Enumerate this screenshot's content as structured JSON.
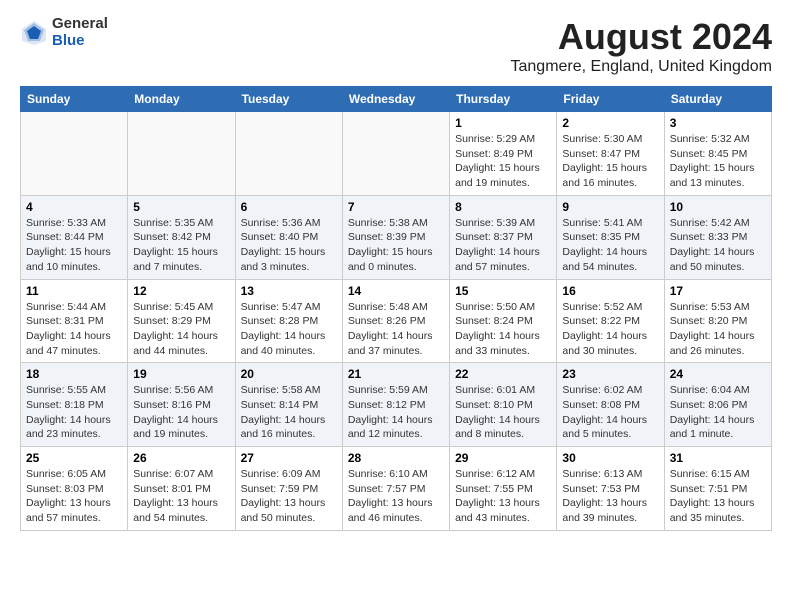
{
  "header": {
    "logo_general": "General",
    "logo_blue": "Blue",
    "month_title": "August 2024",
    "location": "Tangmere, England, United Kingdom"
  },
  "weekdays": [
    "Sunday",
    "Monday",
    "Tuesday",
    "Wednesday",
    "Thursday",
    "Friday",
    "Saturday"
  ],
  "weeks": [
    [
      {
        "day": "",
        "info": ""
      },
      {
        "day": "",
        "info": ""
      },
      {
        "day": "",
        "info": ""
      },
      {
        "day": "",
        "info": ""
      },
      {
        "day": "1",
        "info": "Sunrise: 5:29 AM\nSunset: 8:49 PM\nDaylight: 15 hours\nand 19 minutes."
      },
      {
        "day": "2",
        "info": "Sunrise: 5:30 AM\nSunset: 8:47 PM\nDaylight: 15 hours\nand 16 minutes."
      },
      {
        "day": "3",
        "info": "Sunrise: 5:32 AM\nSunset: 8:45 PM\nDaylight: 15 hours\nand 13 minutes."
      }
    ],
    [
      {
        "day": "4",
        "info": "Sunrise: 5:33 AM\nSunset: 8:44 PM\nDaylight: 15 hours\nand 10 minutes."
      },
      {
        "day": "5",
        "info": "Sunrise: 5:35 AM\nSunset: 8:42 PM\nDaylight: 15 hours\nand 7 minutes."
      },
      {
        "day": "6",
        "info": "Sunrise: 5:36 AM\nSunset: 8:40 PM\nDaylight: 15 hours\nand 3 minutes."
      },
      {
        "day": "7",
        "info": "Sunrise: 5:38 AM\nSunset: 8:39 PM\nDaylight: 15 hours\nand 0 minutes."
      },
      {
        "day": "8",
        "info": "Sunrise: 5:39 AM\nSunset: 8:37 PM\nDaylight: 14 hours\nand 57 minutes."
      },
      {
        "day": "9",
        "info": "Sunrise: 5:41 AM\nSunset: 8:35 PM\nDaylight: 14 hours\nand 54 minutes."
      },
      {
        "day": "10",
        "info": "Sunrise: 5:42 AM\nSunset: 8:33 PM\nDaylight: 14 hours\nand 50 minutes."
      }
    ],
    [
      {
        "day": "11",
        "info": "Sunrise: 5:44 AM\nSunset: 8:31 PM\nDaylight: 14 hours\nand 47 minutes."
      },
      {
        "day": "12",
        "info": "Sunrise: 5:45 AM\nSunset: 8:29 PM\nDaylight: 14 hours\nand 44 minutes."
      },
      {
        "day": "13",
        "info": "Sunrise: 5:47 AM\nSunset: 8:28 PM\nDaylight: 14 hours\nand 40 minutes."
      },
      {
        "day": "14",
        "info": "Sunrise: 5:48 AM\nSunset: 8:26 PM\nDaylight: 14 hours\nand 37 minutes."
      },
      {
        "day": "15",
        "info": "Sunrise: 5:50 AM\nSunset: 8:24 PM\nDaylight: 14 hours\nand 33 minutes."
      },
      {
        "day": "16",
        "info": "Sunrise: 5:52 AM\nSunset: 8:22 PM\nDaylight: 14 hours\nand 30 minutes."
      },
      {
        "day": "17",
        "info": "Sunrise: 5:53 AM\nSunset: 8:20 PM\nDaylight: 14 hours\nand 26 minutes."
      }
    ],
    [
      {
        "day": "18",
        "info": "Sunrise: 5:55 AM\nSunset: 8:18 PM\nDaylight: 14 hours\nand 23 minutes."
      },
      {
        "day": "19",
        "info": "Sunrise: 5:56 AM\nSunset: 8:16 PM\nDaylight: 14 hours\nand 19 minutes."
      },
      {
        "day": "20",
        "info": "Sunrise: 5:58 AM\nSunset: 8:14 PM\nDaylight: 14 hours\nand 16 minutes."
      },
      {
        "day": "21",
        "info": "Sunrise: 5:59 AM\nSunset: 8:12 PM\nDaylight: 14 hours\nand 12 minutes."
      },
      {
        "day": "22",
        "info": "Sunrise: 6:01 AM\nSunset: 8:10 PM\nDaylight: 14 hours\nand 8 minutes."
      },
      {
        "day": "23",
        "info": "Sunrise: 6:02 AM\nSunset: 8:08 PM\nDaylight: 14 hours\nand 5 minutes."
      },
      {
        "day": "24",
        "info": "Sunrise: 6:04 AM\nSunset: 8:06 PM\nDaylight: 14 hours\nand 1 minute."
      }
    ],
    [
      {
        "day": "25",
        "info": "Sunrise: 6:05 AM\nSunset: 8:03 PM\nDaylight: 13 hours\nand 57 minutes."
      },
      {
        "day": "26",
        "info": "Sunrise: 6:07 AM\nSunset: 8:01 PM\nDaylight: 13 hours\nand 54 minutes."
      },
      {
        "day": "27",
        "info": "Sunrise: 6:09 AM\nSunset: 7:59 PM\nDaylight: 13 hours\nand 50 minutes."
      },
      {
        "day": "28",
        "info": "Sunrise: 6:10 AM\nSunset: 7:57 PM\nDaylight: 13 hours\nand 46 minutes."
      },
      {
        "day": "29",
        "info": "Sunrise: 6:12 AM\nSunset: 7:55 PM\nDaylight: 13 hours\nand 43 minutes."
      },
      {
        "day": "30",
        "info": "Sunrise: 6:13 AM\nSunset: 7:53 PM\nDaylight: 13 hours\nand 39 minutes."
      },
      {
        "day": "31",
        "info": "Sunrise: 6:15 AM\nSunset: 7:51 PM\nDaylight: 13 hours\nand 35 minutes."
      }
    ]
  ]
}
